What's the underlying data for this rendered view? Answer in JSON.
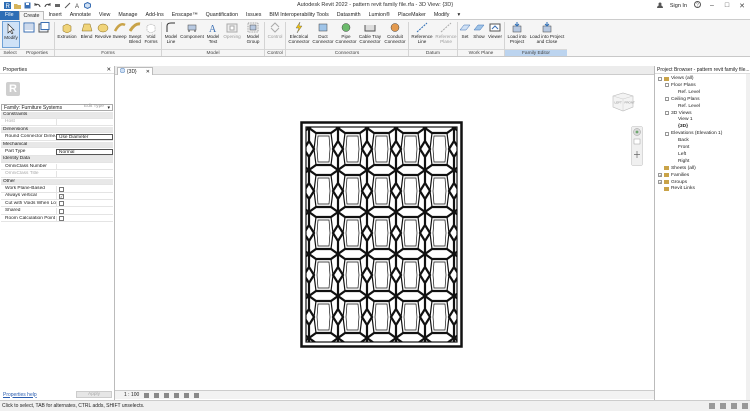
{
  "title": "Autodesk Revit 2022 - pattern revit family file.rfa - 3D View: {3D}",
  "signin": "Sign In",
  "ribbon_tabs": [
    "File",
    "Create",
    "Insert",
    "Annotate",
    "View",
    "Manage",
    "Add-Ins",
    "Enscape™",
    "Quantification",
    "Issues",
    "BIM Interoperability Tools",
    "Datasmith",
    "Lumion®",
    "PlaceMaker",
    "Modify"
  ],
  "active_tab": "Create",
  "ribbon": {
    "modify": "Modify",
    "select": "Select",
    "buttons": [
      "Extrusion",
      "Blend",
      "Revolve",
      "Sweep",
      "Swept Blend",
      "Void Forms",
      "Model Line",
      "Component",
      "Model Text",
      "Opening",
      "Model Group",
      "Control",
      "Electrical Connector",
      "Duct Connector",
      "Pipe Connector",
      "Cable Tray Connector",
      "Conduit Connector",
      "Reference Line",
      "Reference Plane",
      "Set",
      "Show",
      "Viewer",
      "Load into Project",
      "Load into Project and Close"
    ],
    "panels": [
      "Select",
      "Properties",
      "Forms",
      "Model",
      "Control",
      "Connectors",
      "Datum",
      "Work Plane",
      "Family Editor"
    ]
  },
  "properties": {
    "header": "Properties",
    "family": "Family: Furniture Systems",
    "edit_type": "Edit Type",
    "rows": [
      {
        "k": "Constraints",
        "group": true
      },
      {
        "k": "Host",
        "v": "",
        "dim": true
      },
      {
        "k": "Dimensions",
        "group": true
      },
      {
        "k": "Round Connector Dime...",
        "v": "Use Diameter"
      },
      {
        "k": "Mechanical",
        "group": true
      },
      {
        "k": "Part Type",
        "v": "Normal"
      },
      {
        "k": "Identity Data",
        "group": true
      },
      {
        "k": "OmniClass Number",
        "v": ""
      },
      {
        "k": "OmniClass Title",
        "v": "",
        "dim": true
      },
      {
        "k": "Other",
        "group": true
      },
      {
        "k": "Work Plane-Based",
        "check": false
      },
      {
        "k": "Always vertical",
        "check": true
      },
      {
        "k": "Cut with Voids When Lo...",
        "check": false
      },
      {
        "k": "Shared",
        "check": false
      },
      {
        "k": "Room Calculation Point",
        "check": false
      }
    ],
    "help": "Properties help",
    "apply": "Apply"
  },
  "view": {
    "tab": "{3D}",
    "scale": "1 : 100",
    "viewcube_left": "LEFT",
    "viewcube_front": "FRONT"
  },
  "browser": {
    "header": "Project Browser - pattern revit family file...",
    "items": [
      {
        "label": "Views (all)",
        "level": 0,
        "exp": "-",
        "bold": false
      },
      {
        "label": "Floor Plans",
        "level": 1,
        "exp": "-"
      },
      {
        "label": "Ref. Level",
        "level": 2
      },
      {
        "label": "Ceiling Plans",
        "level": 1,
        "exp": "-"
      },
      {
        "label": "Ref. Level",
        "level": 2
      },
      {
        "label": "3D Views",
        "level": 1,
        "exp": "-"
      },
      {
        "label": "View 1",
        "level": 2
      },
      {
        "label": "{3D}",
        "level": 2,
        "bold": true
      },
      {
        "label": "Elevations (Elevation 1)",
        "level": 1,
        "exp": "-"
      },
      {
        "label": "Back",
        "level": 2
      },
      {
        "label": "Front",
        "level": 2
      },
      {
        "label": "Left",
        "level": 2
      },
      {
        "label": "Right",
        "level": 2
      },
      {
        "label": "Sheets (all)",
        "level": 0
      },
      {
        "label": "Families",
        "level": 0,
        "exp": "+"
      },
      {
        "label": "Groups",
        "level": 0,
        "exp": "+"
      },
      {
        "label": "Revit Links",
        "level": 0
      }
    ]
  },
  "status": "Click to select, TAB for alternates, CTRL adds, SHIFT unselects.",
  "colors": {
    "accent": "#2d6db5",
    "ribbon_bg": "#f5f5f5",
    "family_editor": "#bcd4ef"
  }
}
